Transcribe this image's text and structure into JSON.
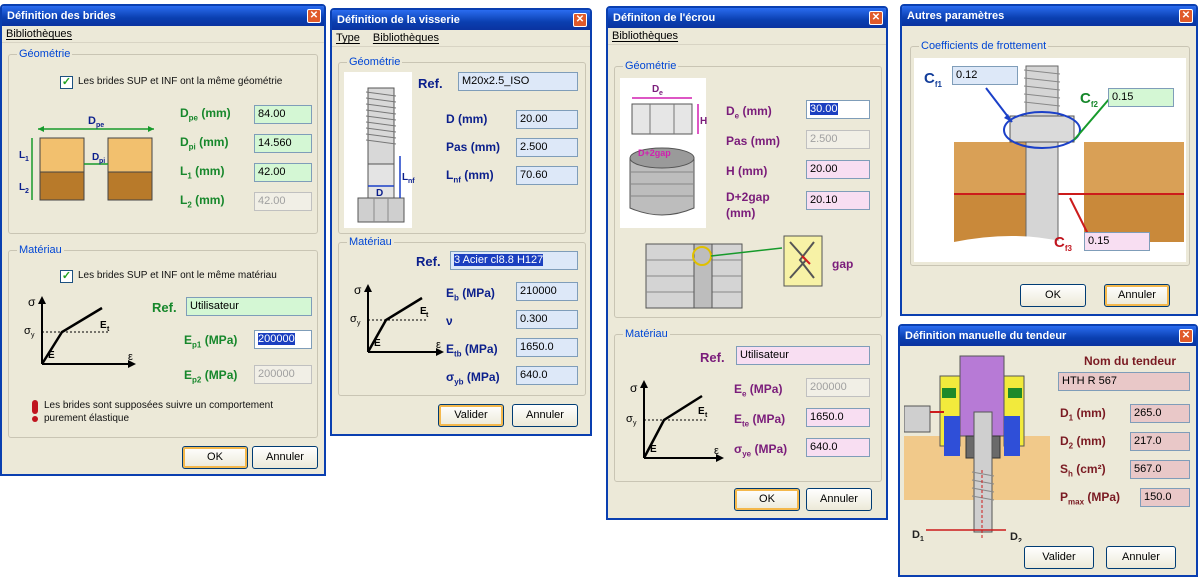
{
  "brides": {
    "title": "Définition des brides",
    "menu": [
      "Bibliothèques"
    ],
    "geom_title": "Géométrie",
    "geom_check": "Les brides SUP et INF ont la même géométrie",
    "diagram": {
      "dpe": "D",
      "dpe_sub": "pe",
      "dpi": "D",
      "dpi_sub": "pi",
      "l1": "L",
      "l1_sub": "1",
      "l2": "L",
      "l2_sub": "2"
    },
    "rows": [
      {
        "label": "D",
        "sub": "pe",
        "unit": " (mm)",
        "value": "84.00"
      },
      {
        "label": "D",
        "sub": "pi",
        "unit": " (mm)",
        "value": "14.560"
      },
      {
        "label": "L",
        "sub": "1",
        "unit": " (mm)",
        "value": "42.00"
      },
      {
        "label": "L",
        "sub": "2",
        "unit": " (mm)",
        "value": "42.00"
      }
    ],
    "mat_title": "Matériau",
    "mat_check": "Les brides SUP et INF ont le même matériau",
    "ref_label": "Ref.",
    "ref_value": "Utilisateur",
    "ep1_label": "E",
    "ep1_sub": "p1",
    "ep1_unit": " (MPa)",
    "ep1_value": "200000",
    "ep2_label": "E",
    "ep2_sub": "p2",
    "ep2_unit": " (MPa)",
    "ep2_value": "200000",
    "note_line1": "Les brides sont supposées suivre un comportement",
    "note_line2": "purement élastique",
    "ok": "OK",
    "cancel": "Annuler",
    "curve": {
      "sigma": "σ",
      "sigma_y": "σ",
      "sigma_y_sub": "y",
      "e": "E",
      "et": "E",
      "et_sub": "t",
      "eps": "ε"
    }
  },
  "visserie": {
    "title": "Définition de la visserie",
    "menu": [
      "Type",
      "Bibliothèques"
    ],
    "geom_title": "Géométrie",
    "ref_label": "Ref.",
    "ref_value": "M20x2.5_ISO",
    "rows": [
      {
        "label": "D",
        "sub": "",
        "unit": " (mm)",
        "value": "20.00"
      },
      {
        "label": "Pas",
        "sub": "",
        "unit": " (mm)",
        "value": "2.500"
      },
      {
        "label": "L",
        "sub": "nf",
        "unit": " (mm)",
        "value": "70.60"
      }
    ],
    "diagram": {
      "d": "D",
      "lnf": "L",
      "lnf_sub": "nf"
    },
    "mat_title": "Matériau",
    "mat_ref_label": "Ref.",
    "mat_ref_value": "3 Acier cl8.8 H127",
    "mat_rows": [
      {
        "label": "E",
        "sub": "b",
        "unit": " (MPa)",
        "value": "210000"
      },
      {
        "label": "ν",
        "sub": "",
        "unit": "",
        "value": "0.300"
      },
      {
        "label": "E",
        "sub": "tb",
        "unit": " (MPa)",
        "value": "1650.0"
      },
      {
        "label": "σ",
        "sub": "yb",
        "unit": " (MPa)",
        "value": "640.0"
      }
    ],
    "ok": "Valider",
    "cancel": "Annuler"
  },
  "ecrou": {
    "title": "Définiton de l'écrou",
    "menu": [
      "Bibliothèques"
    ],
    "geom_title": "Géométrie",
    "rows": [
      {
        "label": "D",
        "sub": "e",
        "unit": " (mm)",
        "value": "30.00"
      },
      {
        "label": "Pas",
        "sub": "",
        "unit": " (mm)",
        "value": "2.500"
      },
      {
        "label": "H",
        "sub": "",
        "unit": " (mm)",
        "value": "20.00"
      },
      {
        "label": "D+2gap",
        "sub": "",
        "unit": "",
        "value": "20.10"
      }
    ],
    "row4_unit": "(mm)",
    "diagram": {
      "de": "D",
      "de_sub": "e",
      "h": "H",
      "d2gap": "D+2gap",
      "gap": "gap"
    },
    "mat_title": "Matériau",
    "ref_label": "Ref.",
    "ref_value": "Utilisateur",
    "mat_rows": [
      {
        "label": "E",
        "sub": "e",
        "unit": " (MPa)",
        "value": "200000"
      },
      {
        "label": "E",
        "sub": "te",
        "unit": " (MPa)",
        "value": "1650.0"
      },
      {
        "label": "σ",
        "sub": "ye",
        "unit": " (MPa)",
        "value": "640.0"
      }
    ],
    "ok": "OK",
    "cancel": "Annuler"
  },
  "autres": {
    "title": "Autres paramètres",
    "group_title": "Coefficients de frottement",
    "cf1_label": "C",
    "cf1_sub": "f1",
    "cf1_value": "0.12",
    "cf2_label": "C",
    "cf2_sub": "f2",
    "cf2_value": "0.15",
    "cf3_label": "C",
    "cf3_sub": "f3",
    "cf3_value": "0.15",
    "ok": "OK",
    "cancel": "Annuler"
  },
  "tendeur": {
    "title": "Définition manuelle du tendeur",
    "name_title": "Nom du tendeur",
    "name_value": "HTH R 567",
    "rows": [
      {
        "label": "D",
        "sub": "1",
        "unit": " (mm)",
        "value": "265.0"
      },
      {
        "label": "D",
        "sub": "2",
        "unit": " (mm)",
        "value": "217.0"
      },
      {
        "label": "S",
        "sub": "h",
        "unit": " (cm²)",
        "value": "567.0"
      },
      {
        "label": "P",
        "sub": "max",
        "unit": " (MPa)",
        "value": "150.0"
      }
    ],
    "diagram": {
      "d1": "D",
      "d1_sub": "1",
      "d2": "D",
      "d2_sub": "2"
    },
    "ok": "Valider",
    "cancel": "Annuler"
  },
  "colors": {
    "title_bar": "#0a3fb0",
    "group_title": "#0046d5",
    "field_green": "#d4f7d4",
    "field_blue": "#dde8f8",
    "field_pink": "#f8def2",
    "field_rose": "#e9c8c8"
  }
}
